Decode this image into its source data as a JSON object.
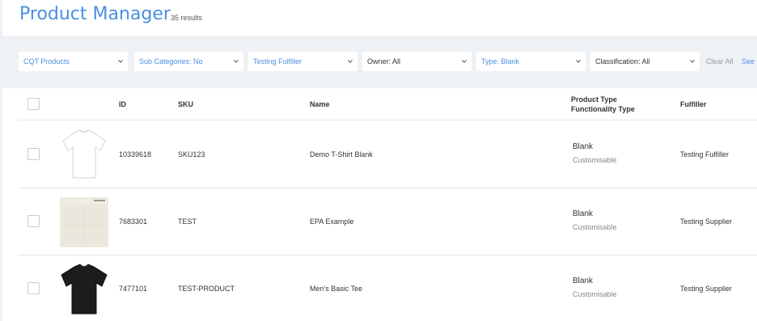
{
  "header": {
    "title": "Product Manager",
    "results": "35 results"
  },
  "filters": {
    "items": [
      {
        "label": "CQT Products",
        "highlight": true
      },
      {
        "label": "Sub Categories: No",
        "highlight": true
      },
      {
        "label": "Testing Fulfiller",
        "highlight": true
      },
      {
        "label": "Owner: All",
        "highlight": false
      },
      {
        "label": "Type: Blank",
        "highlight": true
      },
      {
        "label": "Classification: All",
        "highlight": false
      }
    ],
    "clear_all": "Clear All",
    "see": "See"
  },
  "table": {
    "columns": {
      "id": "ID",
      "sku": "SKU",
      "name": "Name",
      "product_type": "Product Type",
      "functionality_type": "Functionality Type",
      "fulfiller": "Fulfiller"
    },
    "rows": [
      {
        "image": "white-tshirt",
        "id": "10339618",
        "sku": "SKU123",
        "name": "Demo T-Shirt Blank",
        "type": "Blank",
        "functionality": "Customisable",
        "fulfiller": "Testing Fulfiller"
      },
      {
        "image": "epa-document",
        "id": "7683301",
        "sku": "TEST",
        "name": "EPA Example",
        "type": "Blank",
        "functionality": "Customisable",
        "fulfiller": "Testing Supplier"
      },
      {
        "image": "black-tshirt",
        "id": "7477101",
        "sku": "TEST-PRODUCT",
        "name": "Men's Basic Tee",
        "type": "Blank",
        "functionality": "Customisable",
        "fulfiller": "Testing Supplier"
      }
    ]
  },
  "colors": {
    "accent": "#4a90e2",
    "filter_bar_bg": "#eff2f5"
  }
}
